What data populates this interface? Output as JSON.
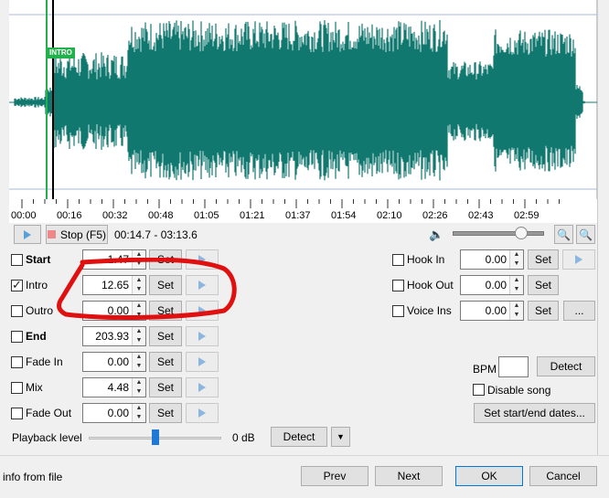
{
  "waveform": {
    "marker_label": "INTRO",
    "wave_color": "#117870",
    "marker_color": "#22b14c"
  },
  "timeline": {
    "ticks": [
      "00:00",
      "00:16",
      "00:32",
      "00:48",
      "01:05",
      "01:21",
      "01:37",
      "01:54",
      "02:10",
      "02:26",
      "02:43",
      "02:59"
    ]
  },
  "transport": {
    "stop_label": "Stop (F5)",
    "time_range": "00:14.7 - 03:13.6"
  },
  "left_fields": [
    {
      "label": "Start",
      "bold": true,
      "checked": false,
      "value": "1.47"
    },
    {
      "label": "Intro",
      "bold": false,
      "checked": true,
      "value": "12.65"
    },
    {
      "label": "Outro",
      "bold": false,
      "checked": false,
      "value": "0.00"
    },
    {
      "label": "End",
      "bold": true,
      "checked": false,
      "value": "203.93"
    },
    {
      "label": "Fade In",
      "bold": false,
      "checked": false,
      "value": "0.00"
    },
    {
      "label": "Mix",
      "bold": false,
      "checked": false,
      "value": "4.48"
    },
    {
      "label": "Fade Out",
      "bold": false,
      "checked": false,
      "value": "0.00"
    }
  ],
  "right_fields": [
    {
      "label": "Hook In",
      "checked": false,
      "value": "0.00"
    },
    {
      "label": "Hook Out",
      "checked": false,
      "value": "0.00"
    },
    {
      "label": "Voice Ins",
      "checked": false,
      "value": "0.00"
    }
  ],
  "set_label": "Set",
  "more_label": "...",
  "playback": {
    "label": "Playback level",
    "db": "0 dB",
    "detect_label": "Detect",
    "level": 0.5
  },
  "bpm": {
    "label": "BPM",
    "value": "",
    "detect_label": "Detect"
  },
  "disable_song": "Disable song",
  "set_dates": "Set start/end dates...",
  "footer": {
    "info": "info from file",
    "prev": "Prev",
    "next": "Next",
    "ok": "OK",
    "cancel": "Cancel"
  }
}
